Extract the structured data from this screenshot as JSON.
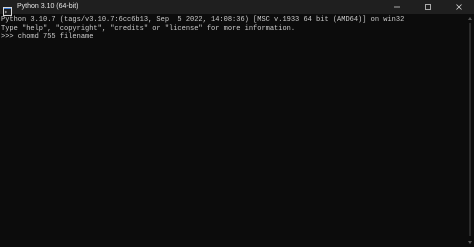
{
  "window": {
    "title": "Python 3.10 (64-bit)",
    "app_icon": "python-console-icon",
    "controls": [
      "minimize-icon",
      "maximize-icon",
      "close-icon"
    ]
  },
  "console": {
    "lines": [
      "Python 3.10.7 (tags/v3.10.7:6cc6b13, Sep  5 2022, 14:08:36) [MSC v.1933 64 bit (AMD64)] on win32",
      "Type \"help\", \"copyright\", \"credits\" or \"license\" for more information.",
      ">>> chomd 755 filename"
    ]
  },
  "colors": {
    "background": "#0c0c0c",
    "titlebar": "#1f1f1f",
    "text": "#cccccc"
  }
}
